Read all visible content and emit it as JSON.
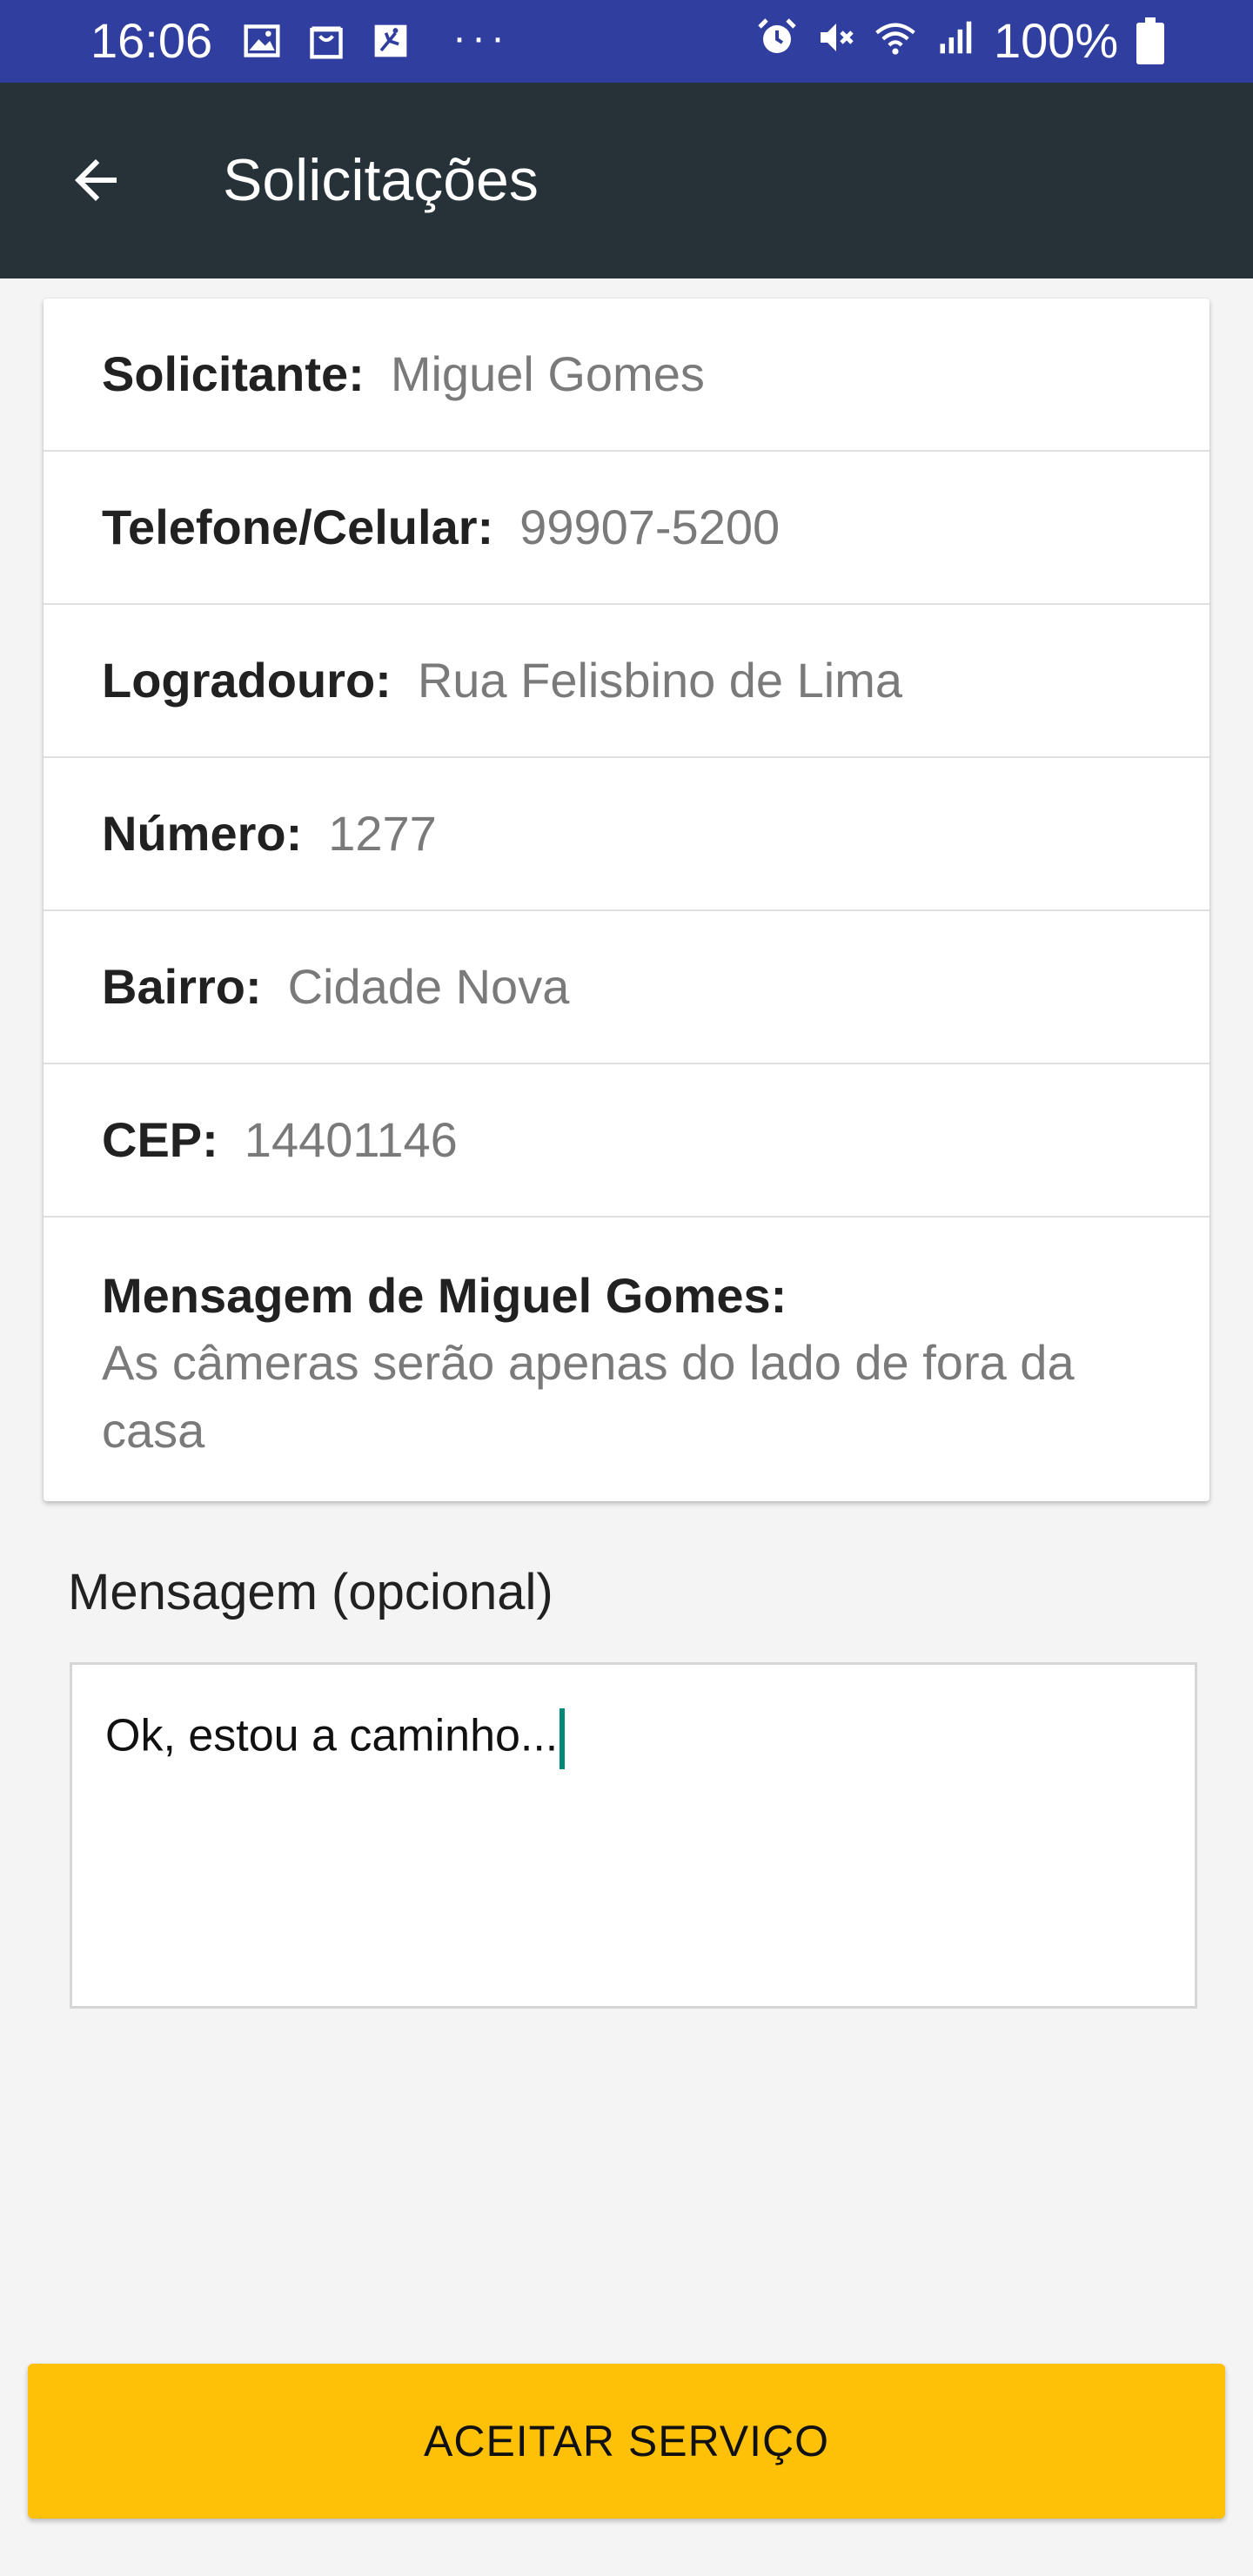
{
  "status_bar": {
    "time": "16:06",
    "more_indicator": "···",
    "battery_text": "100%",
    "left_icons": [
      "image-icon",
      "bag-icon",
      "app-icon"
    ],
    "right_icons": [
      "alarm-icon",
      "mute-icon",
      "wifi-icon",
      "signal-icon",
      "battery-icon"
    ],
    "background_color": "#303f9f"
  },
  "app_bar": {
    "title": "Solicitações",
    "back_icon": "arrow-back-icon",
    "background_color": "#263238"
  },
  "details": {
    "requester": {
      "label": "Solicitante:",
      "value": "Miguel Gomes"
    },
    "phone": {
      "label": "Telefone/Celular:",
      "value": "99907-5200"
    },
    "street": {
      "label": "Logradouro:",
      "value": "Rua Felisbino de Lima"
    },
    "number": {
      "label": "Número:",
      "value": "1277"
    },
    "district": {
      "label": "Bairro:",
      "value": "Cidade Nova"
    },
    "zip": {
      "label": "CEP:",
      "value": "14401146"
    },
    "message": {
      "title": "Mensagem de Miguel Gomes:",
      "text": "As câmeras serão apenas do lado de fora da casa"
    }
  },
  "optional_message": {
    "label": "Mensagem (opcional)",
    "value": "Ok, estou a caminho..."
  },
  "actions": {
    "accept_label": "ACEITAR SERVIÇO",
    "accent_color": "#ffc107"
  }
}
